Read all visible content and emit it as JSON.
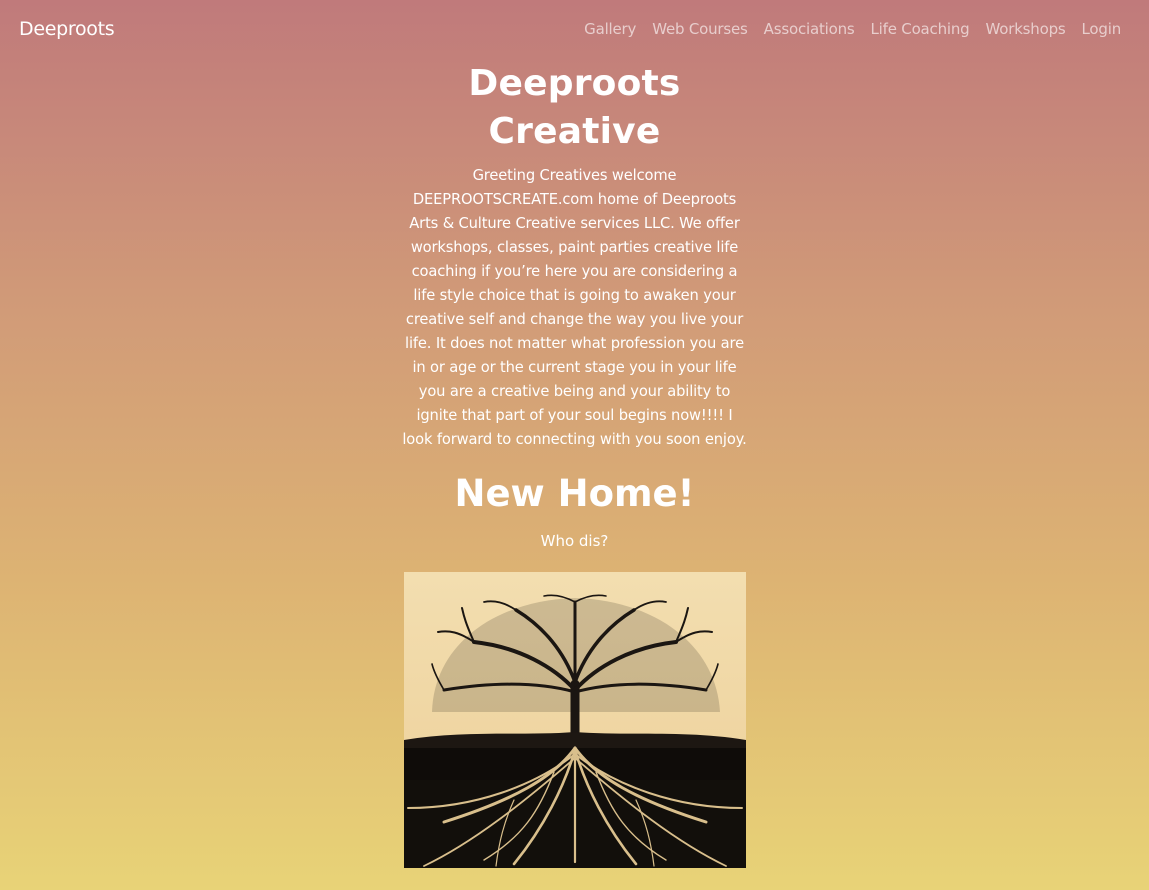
{
  "navbar": {
    "brand": "Deeproots",
    "links": [
      "Gallery",
      "Web Courses",
      "Associations",
      "Life Coaching",
      "Workshops",
      "Login"
    ]
  },
  "main": {
    "title": "Deeproots Creative",
    "intro": "Greeting Creatives welcome DEEPROOTSCREATE.com home of Deeproots Arts & Culture Creative services LLC. We offer workshops, classes, paint parties creative life coaching if you’re here you are considering a life style choice that is going to awaken your creative self and change the way you live your life. It does not matter what profession you are in or age or the current stage you in your life you are a creative being and your ability to ignite that part of your soul begins now!!!! I look forward to connecting with you soon enjoy.",
    "subheading": "New Home!",
    "lead": "Who dis?",
    "image_icon": "tree-of-life-image"
  },
  "colors": {
    "gradient_top": "#c07a7b",
    "gradient_bottom": "#e8d377",
    "text": "#ffffff",
    "nav_link": "rgba(255,255,255,0.62)"
  }
}
